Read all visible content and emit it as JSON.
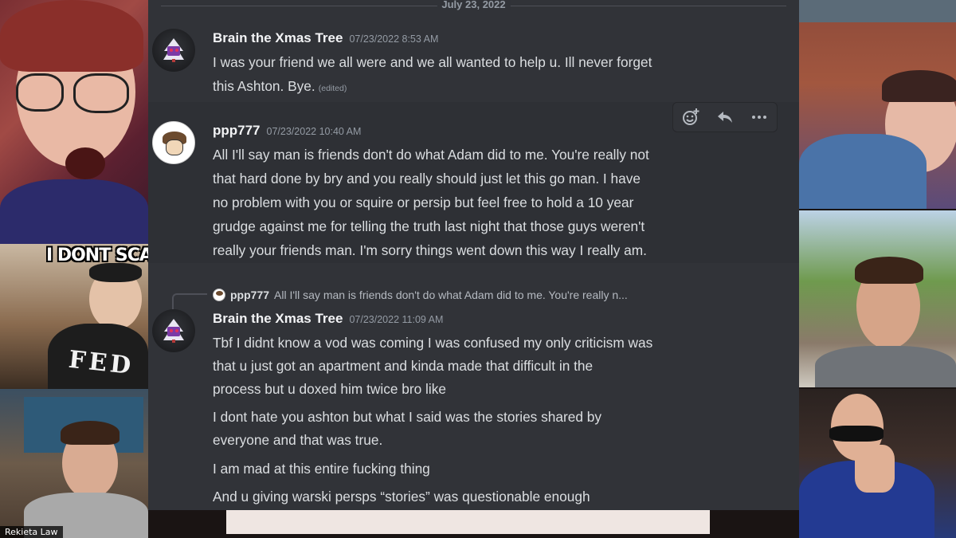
{
  "stream": {
    "meme_caption": "I DONT SCA",
    "shirt_text": "FED",
    "name_tag": "Rekieta Law"
  },
  "discord": {
    "date_divider": "July 23, 2022",
    "messages": [
      {
        "author": "Brain the Xmas Tree",
        "timestamp": "07/23/2022 8:53 AM",
        "lines": [
          "I was your friend we all were and we all wanted to help u. Ill never forget",
          "this Ashton. Bye."
        ],
        "edited_label": "(edited)"
      },
      {
        "author": "ppp777",
        "timestamp": "07/23/2022 10:40 AM",
        "lines": [
          "All I'll say man is friends don't do what Adam did to me. You're really not",
          "that hard done by bry and you really should just let this go man. I have",
          "no problem with you or squire or persip but feel free to hold a 10 year",
          "grudge against me for telling the truth last night that those guys weren't",
          "really your friends man. I'm sorry things went down this way I really am."
        ]
      },
      {
        "reply_to": {
          "author": "ppp777",
          "preview": "All I'll say man is friends don't do what Adam did to me. You're really n..."
        },
        "author": "Brain the Xmas Tree",
        "timestamp": "07/23/2022 11:09 AM",
        "lines": [
          "Tbf I didnt know a vod was coming I was confused my only criticism was",
          "that u just got an apartment and kinda made that difficult in the",
          "process but u doxed him twice bro like",
          "I dont hate you ashton but what I said was the stories shared by",
          "everyone and that was true.",
          "I am mad at this entire fucking thing",
          "And u giving warski persps “stories” was questionable enough"
        ]
      }
    ],
    "toolbar_icons": [
      "add-reaction-icon",
      "reply-icon",
      "more-options-icon"
    ],
    "colors": {
      "background": "#313338",
      "hover_background": "#2e3035",
      "username": "#f2f3f5",
      "text": "#dbdee1",
      "muted": "#949ba4"
    }
  }
}
